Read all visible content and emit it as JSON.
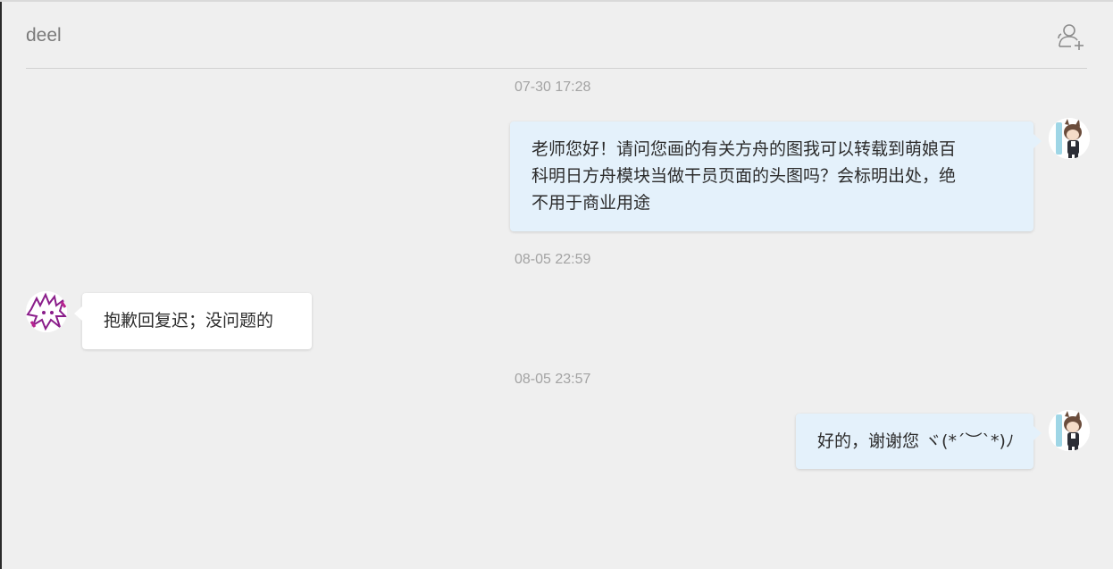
{
  "header": {
    "title": "deel",
    "add_icon": "add-user-icon"
  },
  "colors": {
    "background": "#efefef",
    "outgoing_bubble": "#e4f1fb",
    "incoming_bubble": "#ffffff",
    "timestamp": "#a3a3a3"
  },
  "messages": [
    {
      "time": "07-30 17:28",
      "direction": "outgoing",
      "lines": [
        "老师您好！请问您画的有关方舟的图我可以转载到萌娘百",
        "科明日方舟模块当做干员页面的头图吗？会标明出处，绝",
        "不用于商业用途"
      ],
      "avatar": "self-avatar"
    },
    {
      "time": "08-05 22:59",
      "direction": "incoming",
      "lines": [
        "抱歉回复迟；没问题的"
      ],
      "avatar": "contact-avatar"
    },
    {
      "time": "08-05 23:57",
      "direction": "outgoing",
      "lines": [
        "好的，谢谢您 ヾ(*´︶`*)ﾉ"
      ],
      "avatar": "self-avatar"
    }
  ]
}
